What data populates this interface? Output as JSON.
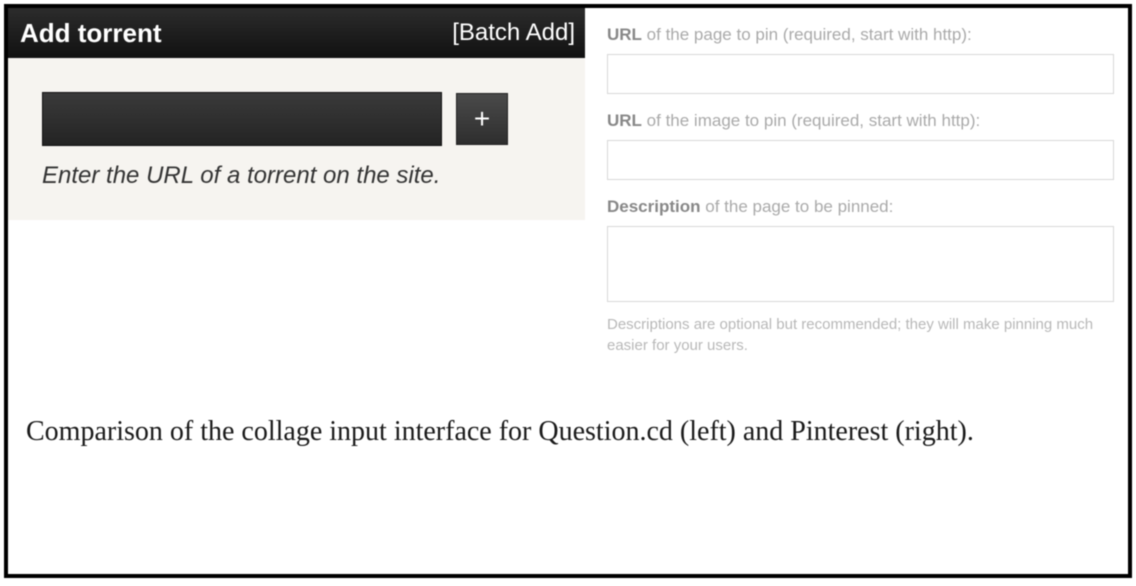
{
  "left": {
    "title": "Add torrent",
    "batch_add": "[Batch Add]",
    "url_value": "",
    "plus_label": "+",
    "hint": "Enter the URL of a torrent on the site."
  },
  "right": {
    "url_page": {
      "bold": "URL",
      "rest": " of the page to pin (required, start with http):",
      "value": ""
    },
    "url_image": {
      "bold": "URL",
      "rest": " of the image to pin (required, start with http):",
      "value": ""
    },
    "description": {
      "bold": "Description",
      "rest": " of the page to be pinned:",
      "value": ""
    },
    "sub_hint": "Descriptions are optional but recommended; they will make pinning much easier for your users."
  },
  "caption": "Comparison of the collage input interface for Question.cd (left) and Pinterest (right)."
}
